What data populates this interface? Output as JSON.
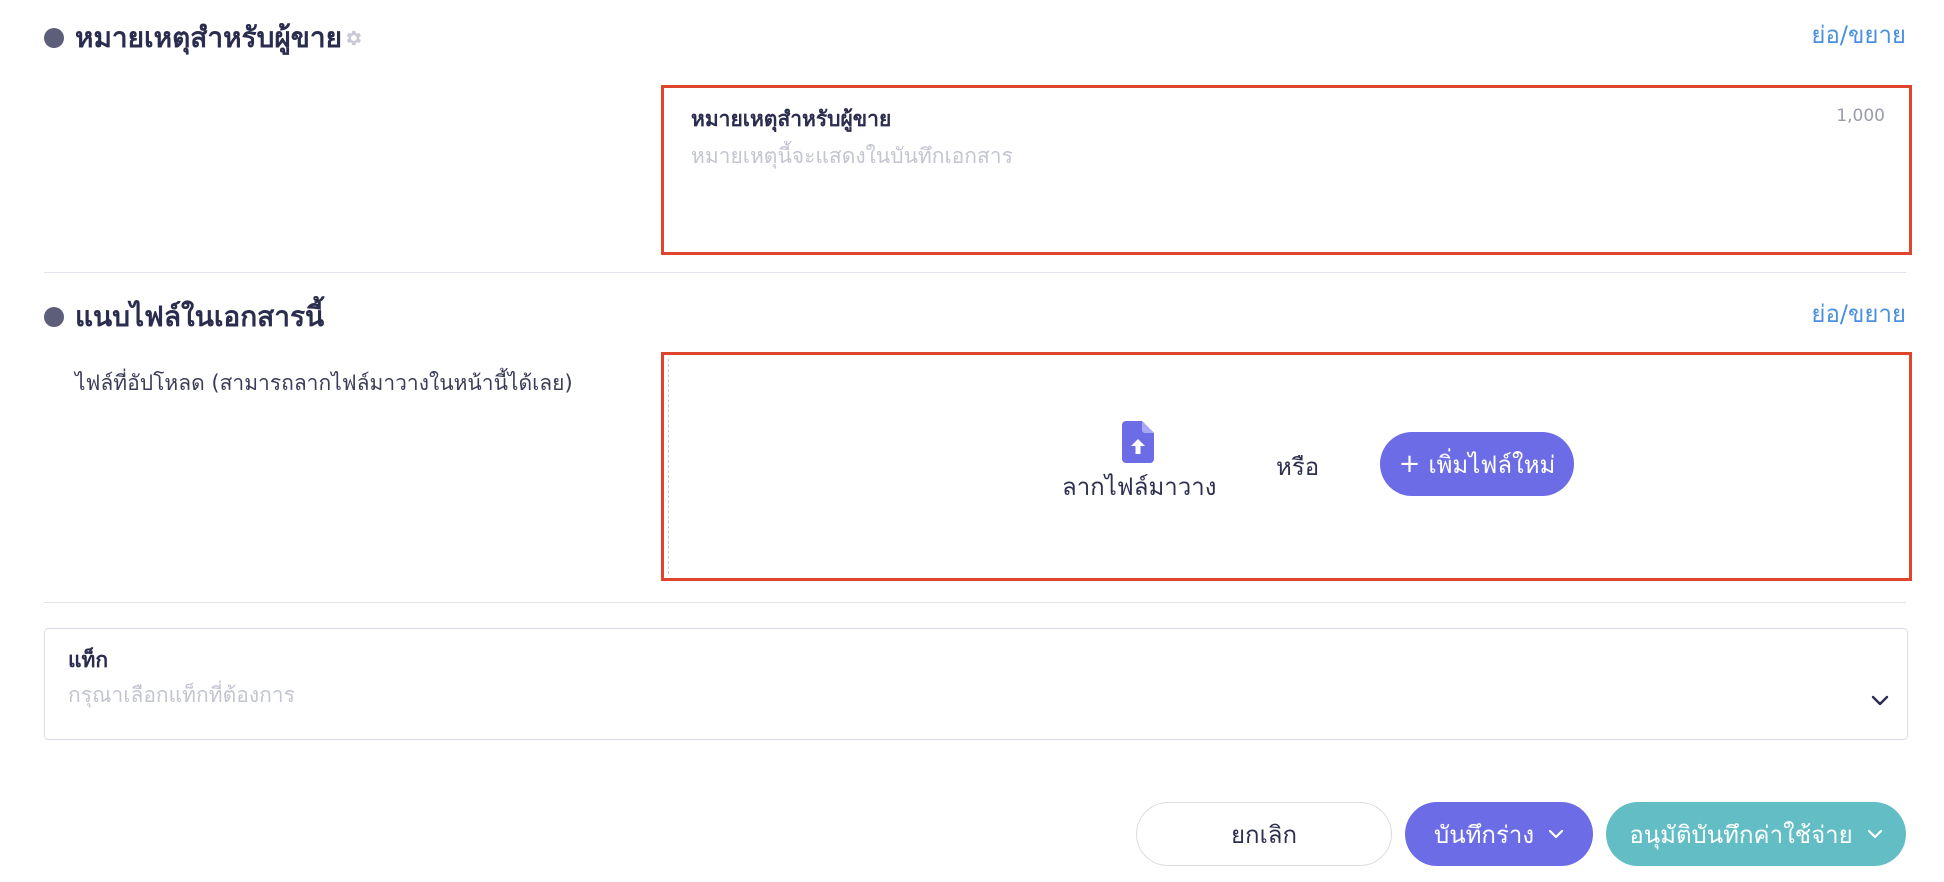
{
  "seller_note_section": {
    "title": "หมายเหตุสำหรับผู้ขาย",
    "toggle_label": "ย่อ/ขยาย",
    "field_label": "หมายเหตุสำหรับผู้ขาย",
    "char_limit": "1,000",
    "placeholder": "หมายเหตุนี้จะแสดงในบันทึกเอกสาร",
    "value": ""
  },
  "attachment_section": {
    "title": "แนบไฟล์ในเอกสารนี้",
    "toggle_label": "ย่อ/ขยาย",
    "upload_hint": "ไฟล์ที่อัปโหลด (สามารถลากไฟล์มาวางในหน้านี้ได้เลย)",
    "drag_label": "ลากไฟล์มาวาง",
    "or_label": "หรือ",
    "add_file_label": "เพิ่มไฟล์ใหม่",
    "add_file_prefix": "+"
  },
  "tag_field": {
    "label": "แท็ก",
    "placeholder": "กรุณาเลือกแท็กที่ต้องการ"
  },
  "footer": {
    "cancel_label": "ยกเลิก",
    "save_draft_label": "บันทึกร่าง",
    "approve_label": "อนุมัติบันทึกค่าใช้จ่าย"
  },
  "colors": {
    "primary": "#6c6ce6",
    "approve": "#62bdc4",
    "link": "#4a90e2",
    "highlight_border": "#e0442c"
  }
}
